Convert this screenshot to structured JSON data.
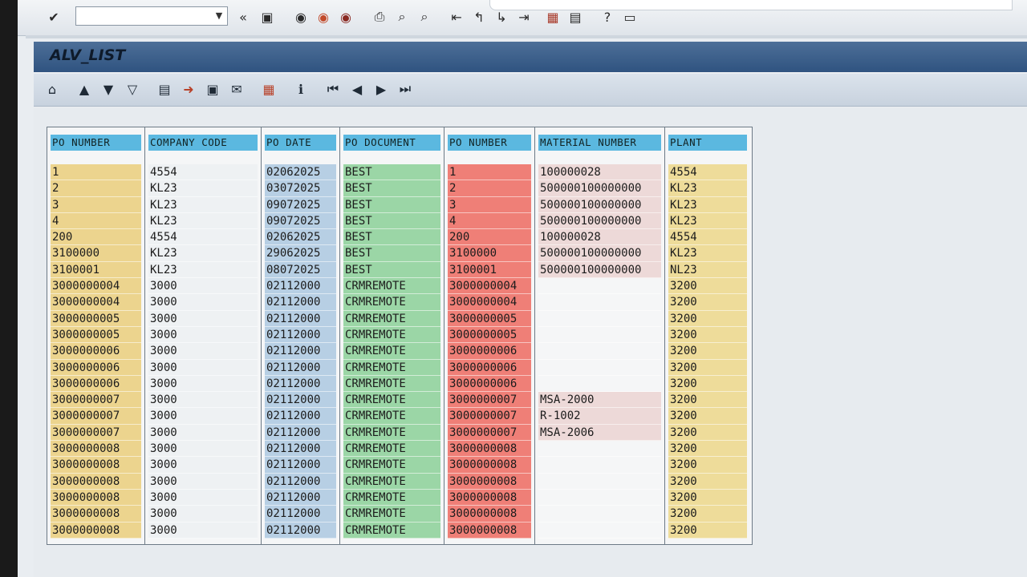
{
  "toolbar": {
    "command_field_value": "",
    "icons": [
      "enter-icon",
      "dropdown-icon",
      "back-history-icon",
      "save-icon",
      "back-icon",
      "exit-icon",
      "cancel-icon",
      "print-icon",
      "find-icon",
      "find-next-icon",
      "first-page-icon",
      "previous-page-icon",
      "next-page-icon",
      "last-page-icon",
      "create-session-icon",
      "shortcut-icon",
      "help-icon",
      "customize-layout-icon"
    ]
  },
  "title": "ALV_LIST",
  "app_toolbar": {
    "icons": [
      "details-icon",
      "sort-ascending-icon",
      "sort-descending-icon",
      "filter-icon",
      "print-preview-icon",
      "export-icon",
      "local-file-icon",
      "send-icon",
      "layout-icon",
      "info-icon",
      "first-icon",
      "previous-icon",
      "next-icon",
      "last-icon"
    ]
  },
  "colors": {
    "header": "#5bb8e0",
    "po_number": "#ecd48e",
    "company_code": "#eef1f3",
    "po_date": "#b7cfe4",
    "po_document": "#9bd6a6",
    "po_number_2": "#ef7f77",
    "material_number": "#edd9d8",
    "plant": "#eedc9a"
  },
  "table": {
    "columns": [
      "PO NUMBER",
      "COMPANY CODE",
      "PO DATE",
      "PO DOCUMENT",
      "PO NUMBER",
      "MATERIAL NUMBER",
      "PLANT"
    ],
    "rows": [
      [
        "1",
        "4554",
        "02062025",
        "BEST",
        "1",
        "100000028",
        "4554"
      ],
      [
        "2",
        "KL23",
        "03072025",
        "BEST",
        "2",
        "500000100000000",
        "KL23"
      ],
      [
        "3",
        "KL23",
        "09072025",
        "BEST",
        "3",
        "500000100000000",
        "KL23"
      ],
      [
        "4",
        "KL23",
        "09072025",
        "BEST",
        "4",
        "500000100000000",
        "KL23"
      ],
      [
        "200",
        "4554",
        "02062025",
        "BEST",
        "200",
        "100000028",
        "4554"
      ],
      [
        "3100000",
        "KL23",
        "29062025",
        "BEST",
        "3100000",
        "500000100000000",
        "KL23"
      ],
      [
        "3100001",
        "KL23",
        "08072025",
        "BEST",
        "3100001",
        "500000100000000",
        "NL23"
      ],
      [
        "3000000004",
        "3000",
        "02112000",
        "CRMREMOTE",
        "3000000004",
        "",
        "3200"
      ],
      [
        "3000000004",
        "3000",
        "02112000",
        "CRMREMOTE",
        "3000000004",
        "",
        "3200"
      ],
      [
        "3000000005",
        "3000",
        "02112000",
        "CRMREMOTE",
        "3000000005",
        "",
        "3200"
      ],
      [
        "3000000005",
        "3000",
        "02112000",
        "CRMREMOTE",
        "3000000005",
        "",
        "3200"
      ],
      [
        "3000000006",
        "3000",
        "02112000",
        "CRMREMOTE",
        "3000000006",
        "",
        "3200"
      ],
      [
        "3000000006",
        "3000",
        "02112000",
        "CRMREMOTE",
        "3000000006",
        "",
        "3200"
      ],
      [
        "3000000006",
        "3000",
        "02112000",
        "CRMREMOTE",
        "3000000006",
        "",
        "3200"
      ],
      [
        "3000000007",
        "3000",
        "02112000",
        "CRMREMOTE",
        "3000000007",
        "MSA-2000",
        "3200"
      ],
      [
        "3000000007",
        "3000",
        "02112000",
        "CRMREMOTE",
        "3000000007",
        "R-1002",
        "3200"
      ],
      [
        "3000000007",
        "3000",
        "02112000",
        "CRMREMOTE",
        "3000000007",
        "MSA-2006",
        "3200"
      ],
      [
        "3000000008",
        "3000",
        "02112000",
        "CRMREMOTE",
        "3000000008",
        "",
        "3200"
      ],
      [
        "3000000008",
        "3000",
        "02112000",
        "CRMREMOTE",
        "3000000008",
        "",
        "3200"
      ],
      [
        "3000000008",
        "3000",
        "02112000",
        "CRMREMOTE",
        "3000000008",
        "",
        "3200"
      ],
      [
        "3000000008",
        "3000",
        "02112000",
        "CRMREMOTE",
        "3000000008",
        "",
        "3200"
      ],
      [
        "3000000008",
        "3000",
        "02112000",
        "CRMREMOTE",
        "3000000008",
        "",
        "3200"
      ],
      [
        "3000000008",
        "3000",
        "02112000",
        "CRMREMOTE",
        "3000000008",
        "",
        "3200"
      ]
    ]
  }
}
